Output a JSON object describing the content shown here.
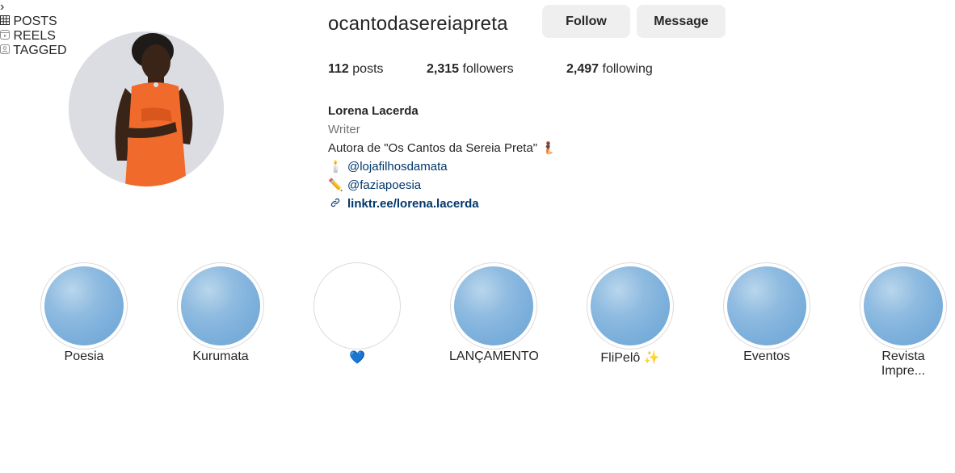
{
  "profile": {
    "username": "ocantodasereiapreta",
    "follow_label": "Follow",
    "message_label": "Message"
  },
  "stats": {
    "posts_count": "112",
    "posts_label": "posts",
    "followers_count": "2,315",
    "followers_label": "followers",
    "following_count": "2,497",
    "following_label": "following"
  },
  "bio": {
    "name": "Lorena Lacerda",
    "category": "Writer",
    "line1": "Autora de \"Os Cantos da Sereia Preta\" 🧜🏿",
    "line2_icon": "🕯️",
    "line2": "@lojafilhosdamata",
    "line3_icon": "✏️",
    "line3": "@faziapoesia",
    "link": "linktr.ee/lorena.lacerda"
  },
  "highlights": [
    {
      "label": "Poesia"
    },
    {
      "label": "Kurumata"
    },
    {
      "label": "💙"
    },
    {
      "label": "LANÇAMENTO"
    },
    {
      "label": "FliPelô ✨"
    },
    {
      "label": "Eventos"
    },
    {
      "label": "Revista Impre..."
    }
  ],
  "tabs": {
    "posts": "POSTS",
    "reels": "REELS",
    "tagged": "TAGGED"
  }
}
